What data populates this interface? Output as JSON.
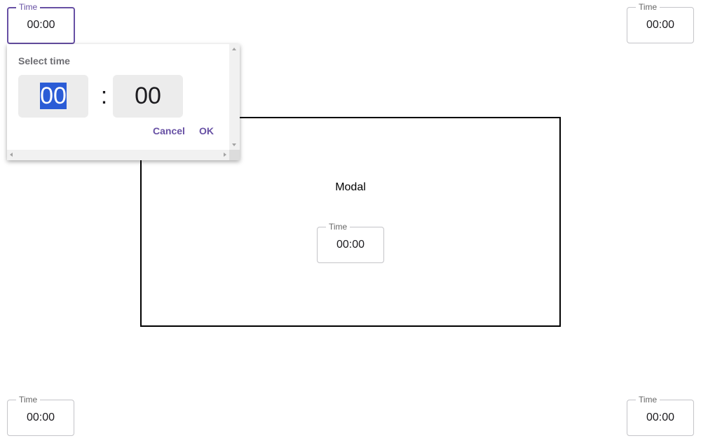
{
  "fields": {
    "top_left": {
      "label": "Time",
      "value": "00:00"
    },
    "top_right": {
      "label": "Time",
      "value": "00:00"
    },
    "bottom_left": {
      "label": "Time",
      "value": "00:00"
    },
    "bottom_right": {
      "label": "Time",
      "value": "00:00"
    },
    "modal": {
      "label": "Time",
      "value": "00:00"
    }
  },
  "modal": {
    "title": "Modal"
  },
  "picker": {
    "heading": "Select time",
    "hours": "00",
    "separator": ":",
    "minutes": "00",
    "cancel_label": "Cancel",
    "ok_label": "OK"
  },
  "colors": {
    "accent": "#6750a4",
    "selection": "#2b5cd6",
    "box_background": "#ececec"
  }
}
